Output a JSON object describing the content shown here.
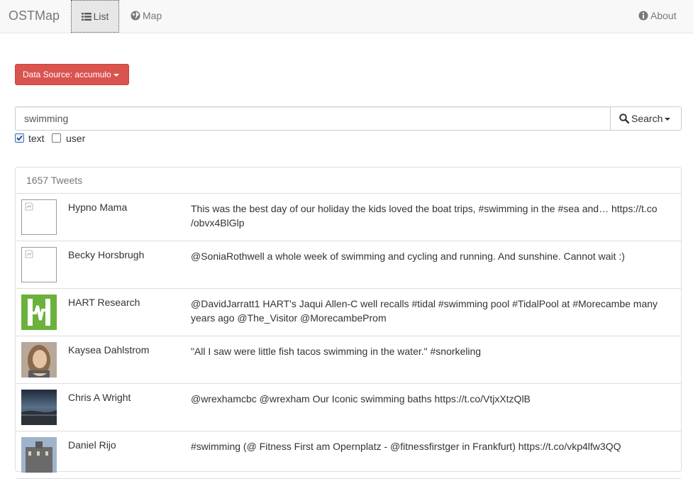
{
  "navbar": {
    "brand": "OSTMap",
    "tabs": [
      {
        "label": "List",
        "icon": "list-icon",
        "active": true
      },
      {
        "label": "Map",
        "icon": "globe-icon"
      }
    ],
    "about": {
      "label": "About",
      "icon": "info-icon"
    }
  },
  "datasource": {
    "label": "Data Source: accumulo"
  },
  "search": {
    "query": "swimming",
    "button_label": "Search"
  },
  "filters": [
    {
      "label": "text",
      "checked": true
    },
    {
      "label": "user",
      "checked": false
    }
  ],
  "results": {
    "count_label": "1657 Tweets",
    "tweets": [
      {
        "user": "Hypno Mama",
        "text": "This was the best day of our holiday the kids loved the boat trips, #swimming in the #sea and… https://t.co /obvx4BlGlp",
        "avatar": "broken-image"
      },
      {
        "user": "Becky Horsbrugh",
        "text": "@SoniaRothwell a whole week of swimming and cycling and running. And sunshine. Cannot wait :)",
        "avatar": "broken-image"
      },
      {
        "user": "HART Research",
        "text": "@DavidJarratt1 HART's Jaqui Allen-C well recalls #tidal #swimming pool #TidalPool at #Morecambe many years ago @The_Visitor @MorecambeProm",
        "avatar": "hart-logo"
      },
      {
        "user": "Kaysea Dahlstrom",
        "text": "\"All I saw were little fish tacos swimming in the water.\" #snorkeling",
        "avatar": "portrait-photo"
      },
      {
        "user": "Chris A Wright",
        "text": "@wrexhamcbc @wrexham Our Iconic swimming baths https://t.co/VtjxXtzQlB",
        "avatar": "landscape-photo"
      },
      {
        "user": "Daniel Rijo",
        "text": "#swimming (@ Fitness First am Opernplatz - @fitnessfirstger in Frankfurt) https://t.co/vkp4lfw3QQ",
        "avatar": "building-photo"
      }
    ]
  },
  "colors": {
    "danger": "#d9534f",
    "hart_green": "#6ab23c",
    "navbar_bg": "#f8f8f8"
  }
}
